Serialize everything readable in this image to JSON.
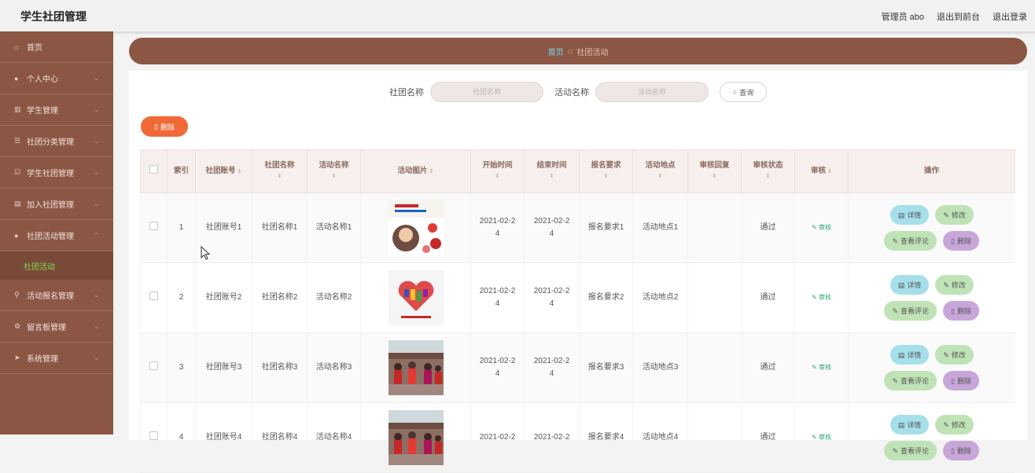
{
  "app": {
    "title": "学生社团管理"
  },
  "topbar": {
    "admin": "管理员 abo",
    "back_front": "退出到前台",
    "logout": "退出登录"
  },
  "sidebar": {
    "items": [
      {
        "label": "首页",
        "icon": "home-icon",
        "has_children": false
      },
      {
        "label": "个人中心",
        "icon": "user-icon",
        "has_children": true
      },
      {
        "label": "学生管理",
        "icon": "chart-icon",
        "has_children": true
      },
      {
        "label": "社团分类管理",
        "icon": "list-icon",
        "has_children": true
      },
      {
        "label": "学生社团管理",
        "icon": "checkbox-icon",
        "has_children": true
      },
      {
        "label": "加入社团管理",
        "icon": "doc-icon",
        "has_children": true
      },
      {
        "label": "社团活动管理",
        "icon": "user-icon",
        "has_children": true,
        "expanded": true
      },
      {
        "label": "活动报名管理",
        "icon": "pin-icon",
        "has_children": true
      },
      {
        "label": "留言板管理",
        "icon": "gear-icon",
        "has_children": true
      },
      {
        "label": "系统管理",
        "icon": "send-icon",
        "has_children": true
      }
    ],
    "active_sub": "社团活动"
  },
  "breadcrumb": {
    "home": "首页",
    "current": "社团活动"
  },
  "search": {
    "label1": "社团名称",
    "placeholder1": "社团名称",
    "label2": "活动名称",
    "placeholder2": "活动名称",
    "button": "查询"
  },
  "toolbar": {
    "delete_label": "删除"
  },
  "table": {
    "headers": {
      "index": "索引",
      "account": "社团账号",
      "club_name": "社团名称",
      "activity_name": "活动名称",
      "image": "活动图片",
      "start": "开始时间",
      "end": "结束时间",
      "requirement": "报名要求",
      "location": "活动地点",
      "reply": "审核回复",
      "status": "审核状态",
      "audit": "审核",
      "ops": "操作"
    },
    "rows": [
      {
        "index": "1",
        "account": "社团账号1",
        "club_name": "社团名称1",
        "activity_name": "活动名称1",
        "start": "2021-02-24",
        "end": "2021-02-24",
        "requirement": "报名要求1",
        "location": "活动地点1",
        "reply": "",
        "status": "通过",
        "audit": "审核",
        "image": "poster"
      },
      {
        "index": "2",
        "account": "社团账号2",
        "club_name": "社团名称2",
        "activity_name": "活动名称2",
        "start": "2021-02-24",
        "end": "2021-02-24",
        "requirement": "报名要求2",
        "location": "活动地点2",
        "reply": "",
        "status": "通过",
        "audit": "审核",
        "image": "heart"
      },
      {
        "index": "3",
        "account": "社团账号3",
        "club_name": "社团名称3",
        "activity_name": "活动名称3",
        "start": "2021-02-24",
        "end": "2021-02-24",
        "requirement": "报名要求3",
        "location": "活动地点3",
        "reply": "",
        "status": "通过",
        "audit": "审核",
        "image": "crowd"
      },
      {
        "index": "4",
        "account": "社团账号4",
        "club_name": "社团名称4",
        "activity_name": "活动名称4",
        "start": "2021-02-2",
        "end": "2021-02-2",
        "requirement": "报名要求4",
        "location": "活动地点4",
        "reply": "",
        "status": "通过",
        "audit": "审核",
        "image": "crowd"
      }
    ],
    "ops": {
      "detail": "详情",
      "edit": "修改",
      "comment": "查看评论",
      "delete": "删除"
    }
  },
  "colors": {
    "brand": "#8b5744",
    "accent_orange": "#f06a38",
    "active_green": "#7ddb4f"
  }
}
